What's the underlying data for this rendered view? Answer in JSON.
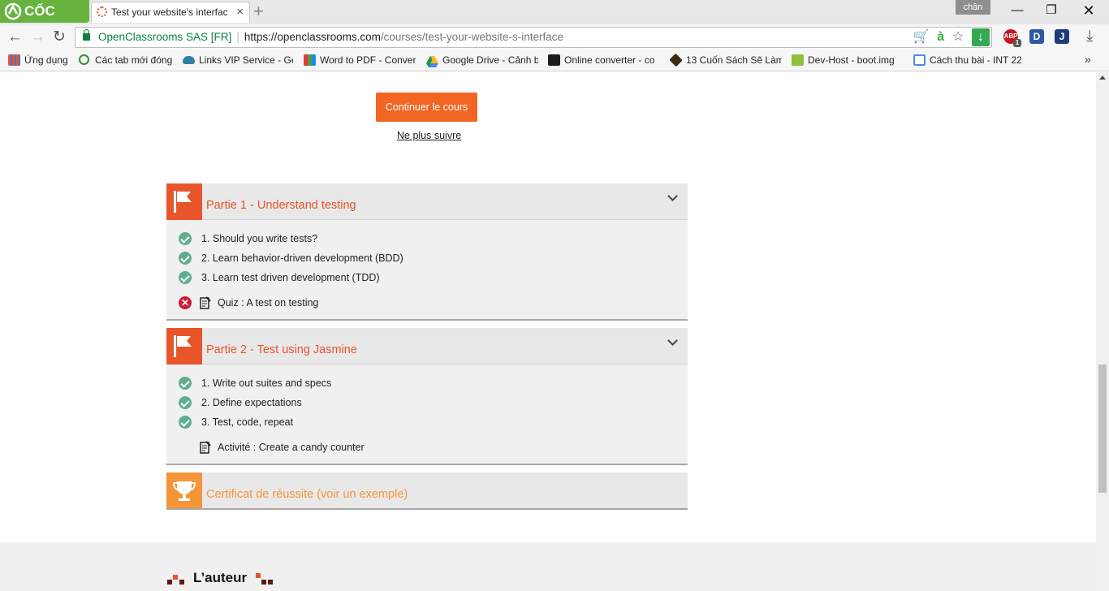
{
  "browser": {
    "logo": "CỐC CỐC",
    "tab_title": "Test your website's interfac",
    "profile": "chân",
    "omnibox": {
      "org": "OpenClassrooms SAS [FR]",
      "url_host": "https://openclassrooms.com",
      "url_path": "/courses/test-your-website-s-interface"
    },
    "extensions": [
      "cart-icon",
      "a-icon",
      "star-icon",
      "download-icon",
      "abp-icon",
      "d-icon",
      "j-icon"
    ],
    "abp_count": "1",
    "bookmarks": [
      {
        "label": "Ứng dụng",
        "icon": "apps-grid-icon"
      },
      {
        "label": "Các tab mới đóng",
        "icon": "history-icon"
      },
      {
        "label": "Links VIP Service - Get",
        "icon": "cloud-icon"
      },
      {
        "label": "Word to PDF - Conver",
        "icon": "colorful-grid-icon"
      },
      {
        "label": "Google Drive - Cảnh b",
        "icon": "google-drive-icon"
      },
      {
        "label": "Online converter - co",
        "icon": "converter-icon"
      },
      {
        "label": "13 Cuốn Sách Sẽ Làm",
        "icon": "box-icon"
      },
      {
        "label": "Dev-Host - boot.img",
        "icon": "devhost-icon"
      },
      {
        "label": "Cách thu bài - INT 22",
        "icon": "doc-icon"
      }
    ]
  },
  "course": {
    "continue_label": "Continuer le cours",
    "unfollow_label": "Ne plus suivre",
    "parts": [
      {
        "title": "Partie 1 - Understand testing",
        "chapters": [
          "1. Should you write tests?",
          "2. Learn behavior-driven development (BDD)",
          "3. Learn test driven development (TDD)"
        ],
        "exercise": "Quiz : A test on testing",
        "exercise_status": "failed"
      },
      {
        "title": "Partie 2 - Test using Jasmine",
        "chapters": [
          "1. Write out suites and specs",
          "2. Define expectations",
          "3. Test, code, repeat"
        ],
        "exercise": "Activité : Create a candy counter",
        "exercise_status": "none"
      }
    ],
    "certificate": "Certificat de réussite (voir un exemple)",
    "author_heading": "L’auteur",
    "colors": {
      "accent": "#f26522",
      "part": "#e8552a",
      "cert": "#f4953a",
      "check": "#5fae8e",
      "fail": "#d2183a"
    }
  }
}
